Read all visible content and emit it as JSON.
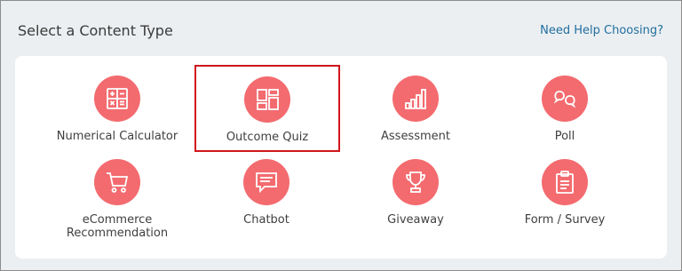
{
  "header": {
    "title": "Select a Content Type",
    "help_link": "Need Help Choosing?"
  },
  "tiles": [
    {
      "label": "Numerical Calculator",
      "icon": "calculator-icon"
    },
    {
      "label": "Outcome Quiz",
      "icon": "layout-grid-icon",
      "selected": true
    },
    {
      "label": "Assessment",
      "icon": "bar-chart-icon"
    },
    {
      "label": "Poll",
      "icon": "chat-bubbles-icon"
    },
    {
      "label": "eCommerce Recommendation",
      "icon": "shopping-cart-icon"
    },
    {
      "label": "Chatbot",
      "icon": "chat-icon"
    },
    {
      "label": "Giveaway",
      "icon": "trophy-icon"
    },
    {
      "label": "Form / Survey",
      "icon": "clipboard-icon"
    }
  ],
  "colors": {
    "accent": "#f36b6f",
    "selected_border": "#d0161c",
    "link": "#1f6ea0"
  }
}
